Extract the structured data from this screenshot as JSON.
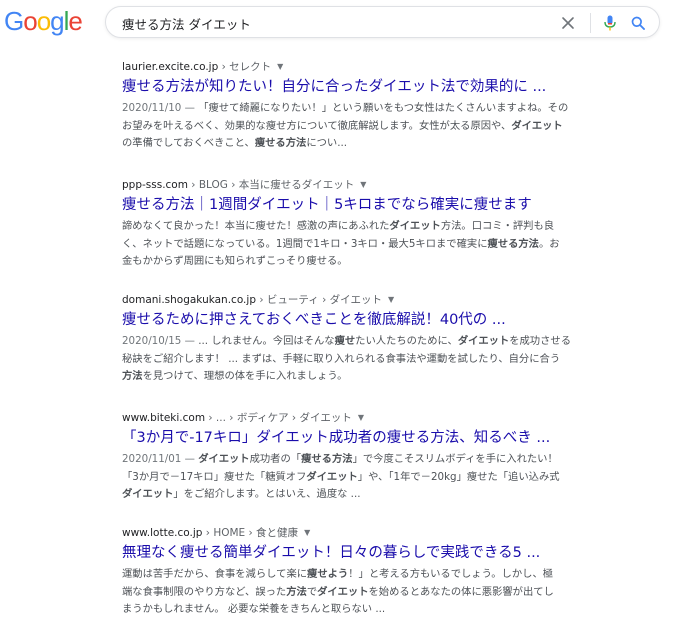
{
  "logo": {
    "letters": [
      "G",
      "o",
      "o",
      "g",
      "l",
      "e"
    ],
    "colors": [
      "#4285f4",
      "#ea4335",
      "#fbbc05",
      "#4285f4",
      "#34a853",
      "#ea4335"
    ]
  },
  "search": {
    "query": "痩せる方法 ダイエット",
    "clear_icon": "close-icon",
    "voice_icon": "microphone-icon",
    "search_icon": "search-icon"
  },
  "results": [
    {
      "site": "laurier.excite.co.jp",
      "path": " › セレクト",
      "title": "痩せる方法が知りたい！自分に合ったダイエット法で効果的に ...",
      "lines": [
        [
          {
            "t": "2020/11/10 — ",
            "c": "date"
          },
          {
            "t": "「痩せて綺麗になりたい！」という願いをもつ女性はたくさんいますよね。その"
          }
        ],
        [
          {
            "t": "お望みを叶えるべく、効果的な痩せ方について徹底解説します。女性が太る原因や、"
          },
          {
            "t": "ダイエット",
            "b": true
          }
        ],
        [
          {
            "t": "の準備でしておくべきこと、"
          },
          {
            "t": "痩せる方法",
            "b": true
          },
          {
            "t": "につい..."
          }
        ]
      ]
    },
    {
      "site": "ppp-sss.com",
      "path": " › BLOG › 本当に痩せるダイエット",
      "title": "痩せる方法｜1週間ダイエット｜5キロまでなら確実に痩せます",
      "lines": [
        [
          {
            "t": "諦めなくて良かった！本当に痩せた！感激の声にあふれた"
          },
          {
            "t": "ダイエット",
            "b": true
          },
          {
            "t": "方法。口コミ・評判も良"
          }
        ],
        [
          {
            "t": "く、ネットで話題になっている。1週間で1キロ・3キロ・最大5キロまで確実に"
          },
          {
            "t": "痩せる方法",
            "b": true
          },
          {
            "t": "。お"
          }
        ],
        [
          {
            "t": "金もかからず周囲にも知られずこっそり痩せる。"
          }
        ]
      ]
    },
    {
      "site": "domani.shogakukan.co.jp",
      "path": " › ビューティ › ダイエット",
      "title": "痩せるために押さえておくべきことを徹底解説！40代の ...",
      "lines": [
        [
          {
            "t": "2020/10/15 — ",
            "c": "date"
          },
          {
            "t": "... しれません。今回はそんな"
          },
          {
            "t": "痩せ",
            "b": true
          },
          {
            "t": "たい人たちのために、"
          },
          {
            "t": "ダイエット",
            "b": true
          },
          {
            "t": "を成功させる"
          }
        ],
        [
          {
            "t": "秘訣をご紹介します！ ... まずは、手軽に取り入れられる食事法や運動を試したり、自分に合う"
          }
        ],
        [
          {
            "t": "方法",
            "b": true
          },
          {
            "t": "を見つけて、理想の体を手に入れましょう。"
          }
        ]
      ]
    },
    {
      "site": "www.biteki.com",
      "path": " › ... › ボディケア › ダイエット",
      "title": "「3か月で-17キロ」ダイエット成功者の痩せる方法、知るべき ...",
      "lines": [
        [
          {
            "t": "2020/11/01 — ",
            "c": "date"
          },
          {
            "t": "ダイエット",
            "b": true
          },
          {
            "t": "成功者の「"
          },
          {
            "t": "痩せる方法",
            "b": true
          },
          {
            "t": "」で今度こそスリムボディを手に入れたい！"
          }
        ],
        [
          {
            "t": "「3か月で－17キロ」痩せた「糖質オフ"
          },
          {
            "t": "ダイエット",
            "b": true
          },
          {
            "t": "」や、「1年で－20kg」痩せた「追い込み式"
          }
        ],
        [
          {
            "t": "ダイエット",
            "b": true
          },
          {
            "t": "」をご紹介します。とはいえ、過度な ..."
          }
        ]
      ]
    },
    {
      "site": "www.lotte.co.jp",
      "path": " › HOME › 食と健康",
      "title": "無理なく痩せる簡単ダイエット！日々の暮らしで実践できる5 ...",
      "lines": [
        [
          {
            "t": "運動は苦手だから、食事を減らして楽に"
          },
          {
            "t": "痩せよう",
            "b": true
          },
          {
            "t": "！」と考える方もいるでしょう。しかし、極"
          }
        ],
        [
          {
            "t": "端な食事制限のやり方など、誤った"
          },
          {
            "t": "方法",
            "b": true
          },
          {
            "t": "で"
          },
          {
            "t": "ダイエット",
            "b": true
          },
          {
            "t": "を始めるとあなたの体に悪影響が出てし"
          }
        ],
        [
          {
            "t": "まうかもしれません。 必要な栄養をきちんと取らない ..."
          }
        ]
      ]
    }
  ]
}
